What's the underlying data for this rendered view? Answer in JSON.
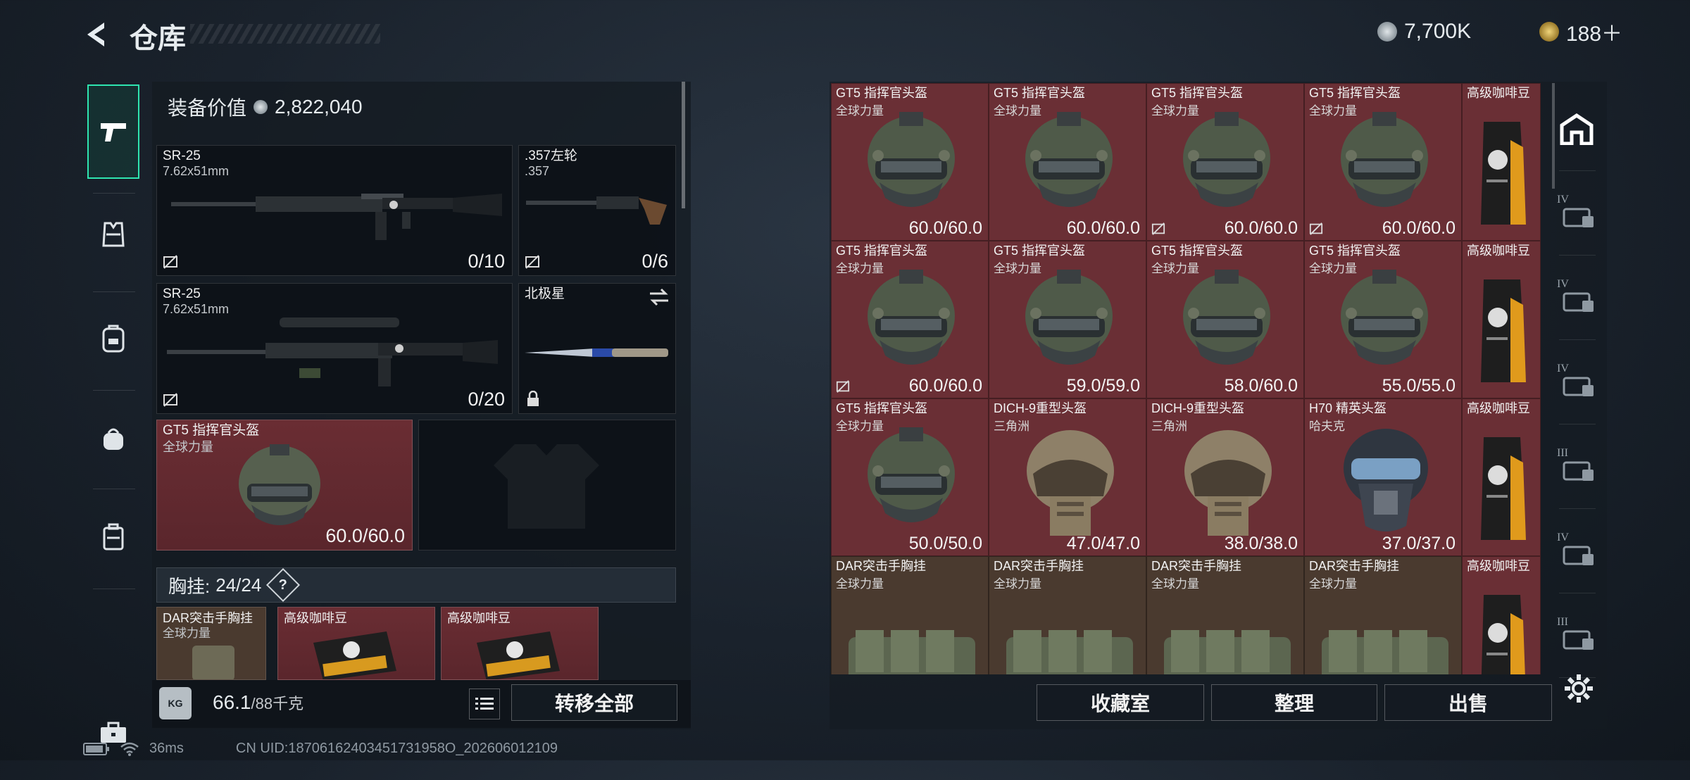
{
  "header": {
    "title": "仓库",
    "currency_silver": "7,700K",
    "currency_gold": "188＋",
    "colors": {
      "silver": "#b9c2c9",
      "gold": "#c8a24a"
    }
  },
  "sidebar": {
    "items": [
      {
        "icon": "pistol-icon",
        "active": true
      },
      {
        "icon": "vest-icon",
        "active": false
      },
      {
        "icon": "backpack-icon",
        "active": false
      },
      {
        "icon": "bag-icon",
        "active": false
      },
      {
        "icon": "case-icon",
        "active": false
      },
      {
        "icon": "toolbox-icon",
        "active": false
      }
    ]
  },
  "loadout": {
    "equip_value_label": "装备价值",
    "equip_value": "2,822,040",
    "primary": {
      "name": "SR-25",
      "caliber": "7.62x51mm",
      "ammo": "0/10"
    },
    "pistol": {
      "name": ".357左轮",
      "caliber": ".357",
      "ammo": "0/6"
    },
    "secondary": {
      "name": "SR-25",
      "caliber": "7.62x51mm",
      "ammo": "0/20"
    },
    "melee": {
      "name": "北极星"
    },
    "helmet": {
      "name": "GT5 指挥官头盔",
      "source": "全球力量",
      "durability": "60.0/60.0"
    },
    "chest_rig_label": "胸挂:",
    "chest_rig_capacity": "24/24",
    "help_mark": "?",
    "rig_items": [
      {
        "name": "DAR突击手胸挂",
        "source": "全球力量"
      },
      {
        "name": "高级咖啡豆"
      },
      {
        "name": "高级咖啡豆"
      }
    ],
    "weight": "66.1",
    "weight_max": "/88千克",
    "kg_badge": "KG",
    "transfer_all": "转移全部"
  },
  "storage": {
    "rows": [
      [
        {
          "name": "GT5 指挥官头盔",
          "source": "全球力量",
          "durability": "60.0/60.0",
          "type": "helmet-gt5",
          "nodur": false
        },
        {
          "name": "GT5 指挥官头盔",
          "source": "全球力量",
          "durability": "60.0/60.0",
          "type": "helmet-gt5",
          "nodur": false
        },
        {
          "name": "GT5 指挥官头盔",
          "source": "全球力量",
          "durability": "60.0/60.0",
          "type": "helmet-gt5",
          "nodur": true
        },
        {
          "name": "GT5 指挥官头盔",
          "source": "全球力量",
          "durability": "60.0/60.0",
          "type": "helmet-gt5",
          "nodur": true
        },
        {
          "name": "高级咖啡豆",
          "type": "coffee"
        }
      ],
      [
        {
          "name": "GT5 指挥官头盔",
          "source": "全球力量",
          "durability": "60.0/60.0",
          "type": "helmet-gt5",
          "nodur": true
        },
        {
          "name": "GT5 指挥官头盔",
          "source": "全球力量",
          "durability": "59.0/59.0",
          "type": "helmet-gt5",
          "nodur": false
        },
        {
          "name": "GT5 指挥官头盔",
          "source": "全球力量",
          "durability": "58.0/60.0",
          "type": "helmet-gt5",
          "nodur": false
        },
        {
          "name": "GT5 指挥官头盔",
          "source": "全球力量",
          "durability": "55.0/55.0",
          "type": "helmet-gt5",
          "nodur": false
        },
        {
          "name": "高级咖啡豆",
          "type": "coffee"
        }
      ],
      [
        {
          "name": "GT5 指挥官头盔",
          "source": "全球力量",
          "durability": "50.0/50.0",
          "type": "helmet-gt5",
          "nodur": false
        },
        {
          "name": "DICH-9重型头盔",
          "source": "三角洲",
          "durability": "47.0/47.0",
          "type": "helmet-dich",
          "nodur": false
        },
        {
          "name": "DICH-9重型头盔",
          "source": "三角洲",
          "durability": "38.0/38.0",
          "type": "helmet-dich",
          "nodur": false
        },
        {
          "name": "H70 精英头盔",
          "source": "哈夫克",
          "durability": "37.0/37.0",
          "type": "helmet-h70",
          "nodur": false
        },
        {
          "name": "高级咖啡豆",
          "type": "coffee"
        }
      ],
      [
        {
          "name": "DAR突击手胸挂",
          "source": "全球力量",
          "type": "rig"
        },
        {
          "name": "DAR突击手胸挂",
          "source": "全球力量",
          "type": "rig"
        },
        {
          "name": "DAR突击手胸挂",
          "source": "全球力量",
          "type": "rig"
        },
        {
          "name": "DAR突击手胸挂",
          "source": "全球力量",
          "type": "rig"
        },
        {
          "name": "高级咖啡豆",
          "type": "coffee"
        }
      ]
    ],
    "buttons": {
      "collection": "收藏室",
      "sort": "整理",
      "sell": "出售"
    }
  },
  "right_sidebar": {
    "items": [
      {
        "icon": "storage-home-icon",
        "tier": ""
      },
      {
        "icon": "tier4-case-icon",
        "tier": "IV"
      },
      {
        "icon": "tier4-folder-icon",
        "tier": "IV"
      },
      {
        "icon": "tier4-camera-icon",
        "tier": "IV"
      },
      {
        "icon": "tier3-gun-icon",
        "tier": "III"
      },
      {
        "icon": "tier4-warning-icon",
        "tier": "IV"
      },
      {
        "icon": "tier3-card-icon",
        "tier": "III"
      }
    ]
  },
  "status_bar": {
    "ping": "36ms",
    "uid": "CN UID:18706162403451731958O_202606012109"
  }
}
